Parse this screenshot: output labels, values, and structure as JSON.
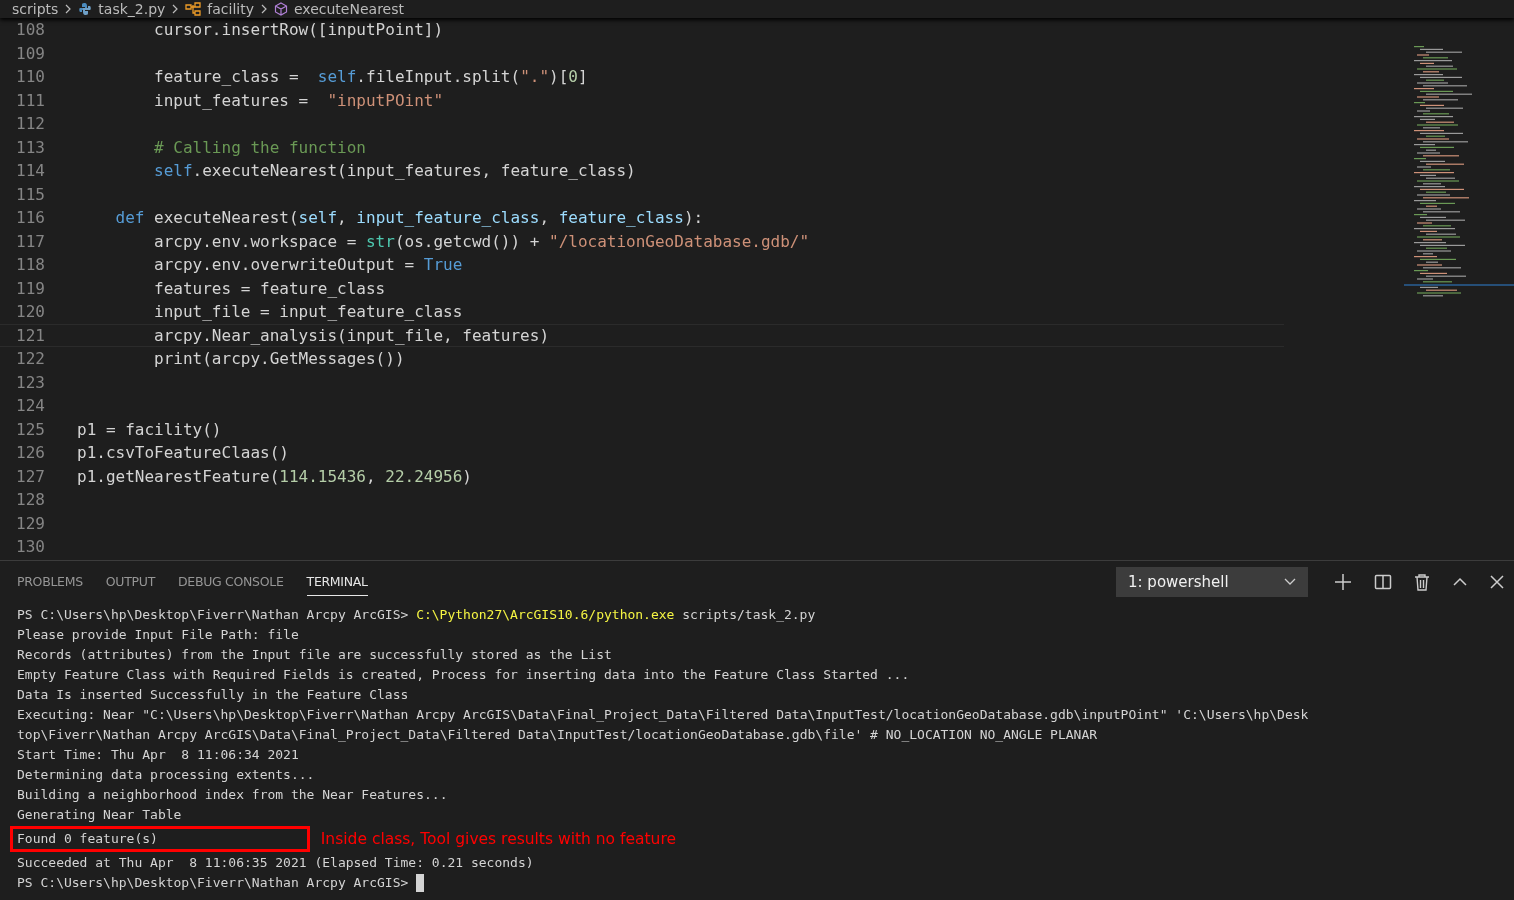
{
  "breadcrumb": [
    {
      "label": "scripts",
      "kind": "folder"
    },
    {
      "label": "task_2.py",
      "kind": "python"
    },
    {
      "label": "facility",
      "kind": "class"
    },
    {
      "label": "executeNearest",
      "kind": "method"
    }
  ],
  "editor": {
    "lines": [
      {
        "number": "108",
        "current": false,
        "tokens": [
          {
            "text": "        cursor.insertRow([inputPoint])",
            "kind": "plain"
          }
        ]
      },
      {
        "number": "109",
        "current": false
      },
      {
        "number": "110",
        "current": false,
        "tokens": [
          {
            "text": "        feature_class =  ",
            "kind": "plain"
          },
          {
            "text": "self",
            "kind": "keyword"
          },
          {
            "text": ".fileInput.split(",
            "kind": "plain"
          },
          {
            "text": "\".\"",
            "kind": "string"
          },
          {
            "text": ")[",
            "kind": "plain"
          },
          {
            "text": "0",
            "kind": "number"
          },
          {
            "text": "]",
            "kind": "plain"
          }
        ]
      },
      {
        "number": "111",
        "current": false,
        "tokens": [
          {
            "text": "        input_features =  ",
            "kind": "plain"
          },
          {
            "text": "\"inputPOint\"",
            "kind": "string"
          }
        ]
      },
      {
        "number": "112",
        "current": false
      },
      {
        "number": "113",
        "current": false,
        "tokens": [
          {
            "text": "        # Calling the function",
            "kind": "comment"
          }
        ]
      },
      {
        "number": "114",
        "current": false,
        "tokens": [
          {
            "text": "        self",
            "kind": "keyword"
          },
          {
            "text": ".executeNearest(input_features, feature_class)",
            "kind": "plain"
          }
        ]
      },
      {
        "number": "115",
        "current": false
      },
      {
        "number": "116",
        "current": false,
        "tokens": [
          {
            "text": "    def",
            "kind": "keyword"
          },
          {
            "text": " executeNearest(",
            "kind": "plain"
          },
          {
            "text": "self",
            "kind": "param"
          },
          {
            "text": ", ",
            "kind": "plain"
          },
          {
            "text": "input_feature_class",
            "kind": "param"
          },
          {
            "text": ", ",
            "kind": "plain"
          },
          {
            "text": "feature_class",
            "kind": "param"
          },
          {
            "text": "):",
            "kind": "plain"
          }
        ]
      },
      {
        "number": "117",
        "current": false,
        "tokens": [
          {
            "text": "        arcpy.env.workspace = ",
            "kind": "plain"
          },
          {
            "text": "str",
            "kind": "builtin"
          },
          {
            "text": "(os.getcwd()) + ",
            "kind": "plain"
          },
          {
            "text": "\"/locationGeoDatabase.gdb/\"",
            "kind": "string"
          }
        ]
      },
      {
        "number": "118",
        "current": false,
        "tokens": [
          {
            "text": "        arcpy.env.overwriteOutput = ",
            "kind": "plain"
          },
          {
            "text": "True",
            "kind": "keyword"
          }
        ]
      },
      {
        "number": "119",
        "current": false,
        "tokens": [
          {
            "text": "        features = feature_class",
            "kind": "plain"
          }
        ]
      },
      {
        "number": "120",
        "current": false,
        "tokens": [
          {
            "text": "        input_file = input_feature_class",
            "kind": "plain"
          }
        ]
      },
      {
        "number": "121",
        "current": true,
        "tokens": [
          {
            "text": "        arcpy.Near_analysis(input_file, features)",
            "kind": "plain"
          }
        ]
      },
      {
        "number": "122",
        "current": false,
        "tokens": [
          {
            "text": "        print(arcpy.GetMessages())",
            "kind": "plain"
          }
        ]
      },
      {
        "number": "123",
        "current": false
      },
      {
        "number": "124",
        "current": false
      },
      {
        "number": "125",
        "current": false,
        "tokens": [
          {
            "text": "p1 = facility()",
            "kind": "plain"
          }
        ]
      },
      {
        "number": "126",
        "current": false,
        "tokens": [
          {
            "text": "p1.csvToFeatureClaas()",
            "kind": "plain"
          }
        ]
      },
      {
        "number": "127",
        "current": false,
        "tokens": [
          {
            "text": "p1.getNearestFeature(",
            "kind": "plain"
          },
          {
            "text": "114.15436",
            "kind": "number"
          },
          {
            "text": ", ",
            "kind": "plain"
          },
          {
            "text": "22.24956",
            "kind": "number"
          },
          {
            "text": ")",
            "kind": "plain"
          }
        ]
      },
      {
        "number": "128",
        "current": false
      },
      {
        "number": "129",
        "current": false
      },
      {
        "number": "130",
        "current": false
      }
    ]
  },
  "panel": {
    "tabs": [
      {
        "label": "PROBLEMS",
        "selected": false
      },
      {
        "label": "OUTPUT",
        "selected": false
      },
      {
        "label": "DEBUG CONSOLE",
        "selected": false
      },
      {
        "label": "TERMINAL",
        "selected": true
      }
    ],
    "terminal_select": "1: powershell",
    "terminal": [
      {
        "kind": "prompt",
        "prompt": "PS C:\\Users\\hp\\Desktop\\Fiverr\\Nathan Arcpy ArcGIS>",
        "command": "C:\\Python27\\ArcGIS10.6/python.exe",
        "args": "scripts/task_2.py"
      },
      {
        "kind": "output",
        "text": "Please provide Input File Path: file"
      },
      {
        "kind": "output",
        "text": "Records (attributes) from the Input file are successfully stored as the List"
      },
      {
        "kind": "output",
        "text": "Empty Feature Class with Required Fields is created, Process for inserting data into the Feature Class Started ..."
      },
      {
        "kind": "output",
        "text": "Data Is inserted Successfully in the Feature Class"
      },
      {
        "kind": "output",
        "text": "Executing: Near \"C:\\Users\\hp\\Desktop\\Fiverr\\Nathan Arcpy ArcGIS\\Data\\Final_Project_Data\\Filtered Data\\InputTest/locationGeoDatabase.gdb\\inputPOint\" 'C:\\Users\\hp\\Desk"
      },
      {
        "kind": "output",
        "text": "top\\Fiverr\\Nathan Arcpy ArcGIS\\Data\\Final_Project_Data\\Filtered Data\\InputTest/locationGeoDatabase.gdb\\file' # NO_LOCATION NO_ANGLE PLANAR"
      },
      {
        "kind": "output",
        "text": "Start Time: Thu Apr  8 11:06:34 2021"
      },
      {
        "kind": "output",
        "text": "Determining data processing extents..."
      },
      {
        "kind": "output",
        "text": "Building a neighborhood index from the Near Features..."
      },
      {
        "kind": "output",
        "text": "Generating Near Table"
      },
      {
        "kind": "highlighted",
        "text": "Found 0 feature(s)",
        "annotation": "Inside class, Tool gives results with no feature"
      },
      {
        "kind": "output",
        "text": "Succeeded at Thu Apr  8 11:06:35 2021 (Elapsed Time: 0.21 seconds)"
      },
      {
        "kind": "cursor",
        "prompt": "PS C:\\Users\\hp\\Desktop\\Fiverr\\Nathan Arcpy ArcGIS>"
      }
    ]
  }
}
